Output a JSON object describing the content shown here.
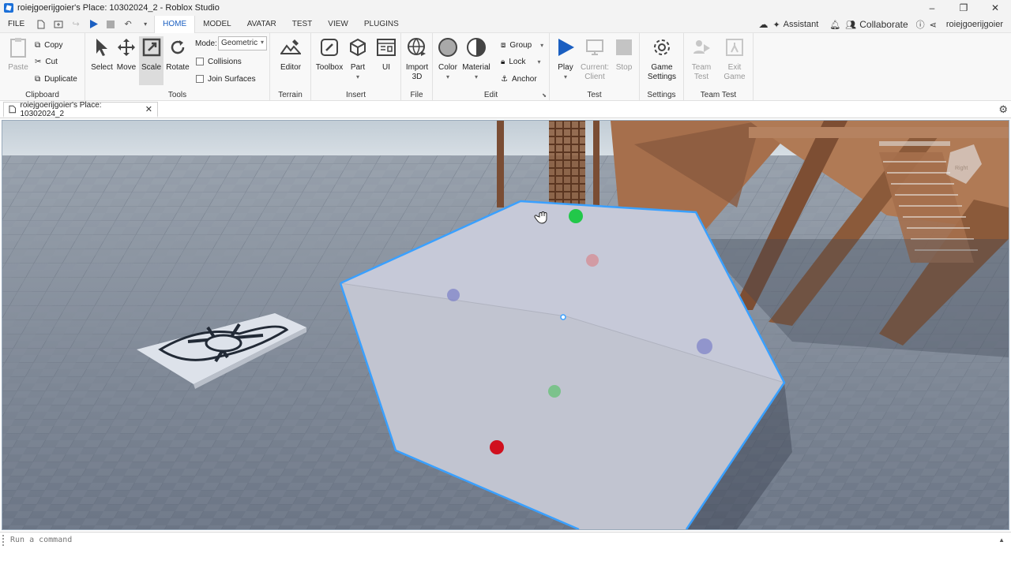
{
  "window": {
    "title": "roiejgoerijgoier's Place: 10302024_2 - Roblox Studio",
    "minimize": "–",
    "maximize": "❐",
    "close": "✕"
  },
  "menu": {
    "file": "FILE",
    "tabs": [
      "HOME",
      "MODEL",
      "AVATAR",
      "TEST",
      "VIEW",
      "PLUGINS"
    ],
    "active_tab": "HOME",
    "assistant": "Assistant",
    "collaborate": "Collaborate",
    "username": "roiejgoerijgoier"
  },
  "ribbon": {
    "clipboard": {
      "label": "Clipboard",
      "paste": "Paste",
      "copy": "Copy",
      "cut": "Cut",
      "duplicate": "Duplicate"
    },
    "tools": {
      "label": "Tools",
      "select": "Select",
      "move": "Move",
      "scale": "Scale",
      "rotate": "Rotate",
      "mode_label": "Mode:",
      "mode_value": "Geometric",
      "collisions": "Collisions",
      "join_surfaces": "Join Surfaces"
    },
    "terrain": {
      "label": "Terrain",
      "editor": "Editor"
    },
    "insert": {
      "label": "Insert",
      "toolbox": "Toolbox",
      "part": "Part",
      "ui": "UI"
    },
    "file": {
      "label": "File",
      "import_line1": "Import",
      "import_line2": "3D"
    },
    "edit": {
      "label": "Edit",
      "color": "Color",
      "material": "Material",
      "group": "Group",
      "lock": "Lock",
      "anchor": "Anchor"
    },
    "test": {
      "label": "Test",
      "play": "Play",
      "current_line1": "Current:",
      "current_line2": "Client",
      "stop": "Stop"
    },
    "settings": {
      "label": "Settings",
      "game_line1": "Game",
      "game_line2": "Settings"
    },
    "team_test": {
      "label": "Team Test",
      "team_line1": "Team",
      "team_line2": "Test",
      "exit_line1": "Exit",
      "exit_line2": "Game"
    }
  },
  "document_tab": {
    "title": "roiejgoerijgoier's Place: 10302024_2",
    "close": "✕"
  },
  "command_bar": {
    "placeholder": "Run a command"
  },
  "colors": {
    "accent": "#1b5fc1",
    "selection": "#3aa0ff",
    "sky": "#c9d4dd",
    "baseplate": "#7d8796",
    "part": "#c8cad6",
    "wood": "#8a5a3e"
  }
}
